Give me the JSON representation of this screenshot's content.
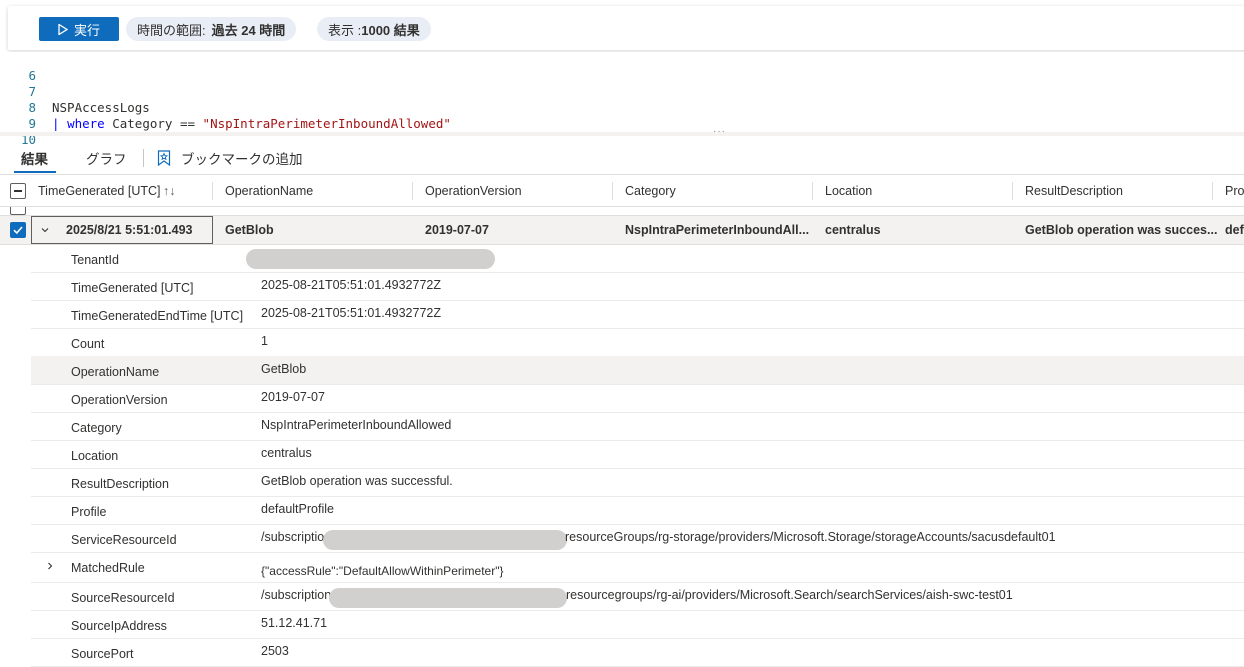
{
  "toolbar": {
    "run_label": "実行",
    "time_range_label": "時間の範囲:",
    "time_range_value": "過去 24 時間",
    "display_label": "表示 : ",
    "display_value": "1000 結果"
  },
  "editor": {
    "lines": [
      {
        "num": "6",
        "text": ""
      },
      {
        "num": "7",
        "text": "NSPAccessLogs"
      },
      {
        "num": "8",
        "pipe": "| ",
        "kw": "where",
        "mid": " Category == ",
        "str": "\"NspIntraPerimeterInboundAllowed\""
      },
      {
        "num": "9",
        "text": ""
      },
      {
        "num": "10",
        "text": ""
      }
    ]
  },
  "tabs": {
    "results": "結果",
    "chart": "グラフ",
    "bookmark": "ブックマークの追加"
  },
  "columns": [
    "TimeGenerated [UTC]",
    "OperationName",
    "OperationVersion",
    "Category",
    "Location",
    "ResultDescription",
    "Pro"
  ],
  "sort_icon": "↑↓",
  "selected_row": {
    "time": "2025/8/21 5:51:01.493",
    "operation": "GetBlob",
    "version": "2019-07-07",
    "category": "NspIntraPerimeterInboundAll...",
    "location": "centralus",
    "result": "GetBlob operation was succes...",
    "profile": "def"
  },
  "details": [
    {
      "name": "TenantId",
      "value": ""
    },
    {
      "name": "TimeGenerated [UTC]",
      "value": "2025-08-21T05:51:01.4932772Z"
    },
    {
      "name": "TimeGeneratedEndTime [UTC]",
      "value": "2025-08-21T05:51:01.4932772Z"
    },
    {
      "name": "Count",
      "value": "1"
    },
    {
      "name": "OperationName",
      "value": "GetBlob"
    },
    {
      "name": "OperationVersion",
      "value": "2019-07-07"
    },
    {
      "name": "Category",
      "value": "NspIntraPerimeterInboundAllowed"
    },
    {
      "name": "Location",
      "value": "centralus"
    },
    {
      "name": "ResultDescription",
      "value": "GetBlob operation was successful."
    },
    {
      "name": "Profile",
      "value": "defaultProfile"
    },
    {
      "name": "ServiceResourceId",
      "value_prefix": "/subscriptio",
      "value_suffix": "resourceGroups/rg-storage/providers/Microsoft.Storage/storageAccounts/sacusdefault01"
    },
    {
      "name": "MatchedRule",
      "value": "{\"accessRule\":\"DefaultAllowWithinPerimeter\"}"
    },
    {
      "name": "SourceResourceId",
      "value_prefix": "/subscription",
      "value_suffix": "resourcegroups/rg-ai/providers/Microsoft.Search/searchServices/aish-swc-test01"
    },
    {
      "name": "SourceIpAddress",
      "value": "51.12.41.71"
    },
    {
      "name": "SourcePort",
      "value": "2503"
    }
  ],
  "colors": {
    "accent": "#0f6cbd",
    "pill_bg": "#e9eef6",
    "row_highlight": "#f3f2f1"
  }
}
